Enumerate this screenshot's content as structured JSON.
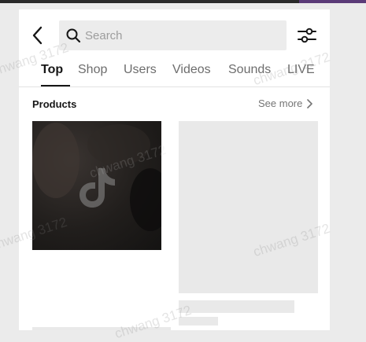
{
  "search": {
    "placeholder": "Search",
    "value": ""
  },
  "tabs": [
    {
      "label": "Top",
      "active": true
    },
    {
      "label": "Shop",
      "active": false
    },
    {
      "label": "Users",
      "active": false
    },
    {
      "label": "Videos",
      "active": false
    },
    {
      "label": "Sounds",
      "active": false
    },
    {
      "label": "LIVE",
      "active": false
    }
  ],
  "products": {
    "title": "Products",
    "see_more_label": "See more"
  },
  "watermark": "chwang 3172",
  "icons": {
    "back": "chevron-left-icon",
    "search": "search-icon",
    "filter": "sliders-icon",
    "chevron": "chevron-right-icon",
    "logo": "tiktok-logo"
  },
  "colors": {
    "active_tab": "#161616",
    "inactive_tab": "#6d6d6d",
    "skeleton": "#e9e9e9",
    "search_bg": "#ececec"
  }
}
